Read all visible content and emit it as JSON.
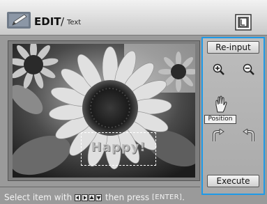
{
  "header": {
    "title": "EDIT",
    "separator": "/",
    "subtitle": "Text",
    "edit_icon": "edit-pencil-icon",
    "print_icon": "print-preview-icon"
  },
  "canvas": {
    "text_stamp": "Happy!"
  },
  "panel": {
    "reinput_label": "Re-input",
    "zoom_in_icon": "zoom-in-icon",
    "zoom_out_icon": "zoom-out-icon",
    "position_icon": "hand-icon",
    "position_label": "Position",
    "rotate_left_icon": "rotate-left-icon",
    "rotate_right_icon": "rotate-right-icon",
    "execute_label": "Execute",
    "accent_color": "#1e9ae8"
  },
  "footer": {
    "hint_prefix": "Select item with",
    "hint_middle": "then press",
    "enter_key": "[ENTER]",
    "hint_suffix": "."
  }
}
